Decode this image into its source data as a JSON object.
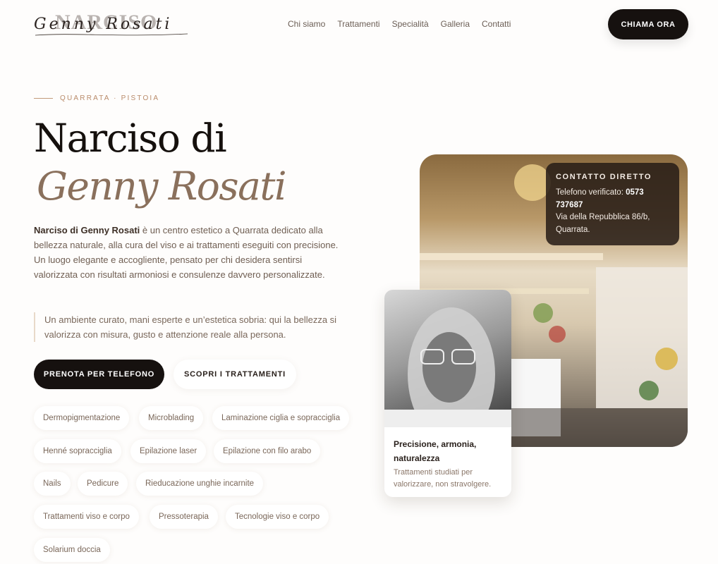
{
  "header": {
    "logo_word": "NARCISO",
    "logo_script": "Genny Rosati",
    "nav": [
      "Chi siamo",
      "Trattamenti",
      "Specialità",
      "Galleria",
      "Contatti"
    ],
    "cta": "CHIAMA ORA"
  },
  "hero": {
    "eyebrow": "QUARRATA · PISTOIA",
    "title_line1": "Narciso di",
    "title_line2": "Genny Rosati",
    "intro_strong": "Narciso di Genny Rosati",
    "intro_rest": " è un centro estetico a Quarrata dedicato alla bellezza naturale, alla cura del viso e ai trattamenti eseguiti con precisione. Un luogo elegante e accogliente, pensato per chi desidera sentirsi valorizzata con risultati armoniosi e consulenze davvero personalizzate.",
    "quote": "Un ambiente curato, mani esperte e un’estetica sobria: qui la bellezza si valorizza con misura, gusto e attenzione reale alla persona.",
    "primary_button": "PRENOTA PER TELEFONO",
    "secondary_button": "SCOPRI I TRATTAMENTI",
    "chips": [
      "Dermopigmentazione",
      "Microblading",
      "Laminazione ciglia e sopracciglia",
      "Henné sopracciglia",
      "Epilazione laser",
      "Epilazione con filo arabo",
      "Nails",
      "Pedicure",
      "Rieducazione unghie incarnite",
      "Trattamenti viso e corpo",
      "Pressoterapia",
      "Tecnologie viso e corpo",
      "Solarium doccia"
    ]
  },
  "contact_card": {
    "title": "CONTATTO DIRETTO",
    "phone_label": "Telefono verificato: ",
    "phone": "0573 737687",
    "address": "Via della Repubblica 86/b, Quarrata."
  },
  "portrait_card": {
    "title": "Precisione, armonia, naturalezza",
    "desc": "Trattamenti studiati per valorizzare, non stravolgere."
  }
}
